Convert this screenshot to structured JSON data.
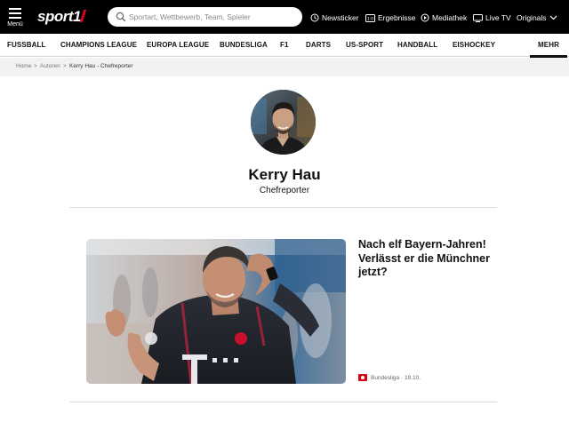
{
  "header": {
    "menu_label": "Menü",
    "logo_text": "sport1",
    "search_placeholder": "Sportart, Wettbewerb, Team, Spieler",
    "nav": [
      {
        "label": "Newsticker",
        "icon": "clock-icon"
      },
      {
        "label": "Ergebnisse",
        "icon": "scoreboard-icon"
      },
      {
        "label": "Mediathek",
        "icon": "play-icon"
      },
      {
        "label": "Live TV",
        "icon": "tv-icon"
      },
      {
        "label": "Originals",
        "icon": "chevron-down-icon"
      }
    ]
  },
  "sport_nav": [
    "FUSSBALL",
    "CHAMPIONS LEAGUE",
    "EUROPA LEAGUE",
    "BUNDESLIGA",
    "F1",
    "DARTS",
    "US-SPORT",
    "HANDBALL",
    "EISHOCKEY",
    "MEHR"
  ],
  "breadcrumb": {
    "items": [
      "Home",
      "Autoren",
      "Kerry Hau - Chefreporter"
    ],
    "separator": ">"
  },
  "author": {
    "name": "Kerry Hau",
    "role": "Chefreporter"
  },
  "article": {
    "headline": "Nach elf Bayern-Jahren! Verlässt er die Münchner jetzt?",
    "category": "Bundesliga",
    "date": "19.10."
  },
  "colors": {
    "topbar_bg": "#000000",
    "brand_red": "#e2001a",
    "breadcrumb_bg": "#f2f2f2"
  }
}
